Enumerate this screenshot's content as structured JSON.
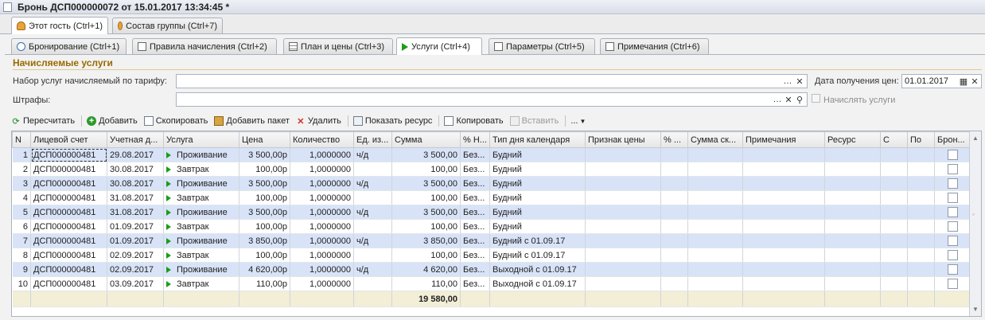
{
  "window": {
    "title": "Бронь ДСП000000072 от 15.01.2017 13:34:45 *"
  },
  "top_tabs": [
    {
      "label": "Этот гость (Ctrl+1)",
      "icon": "person-icon"
    },
    {
      "label": "Состав группы (Ctrl+7)",
      "icon": "group-icon"
    }
  ],
  "sub_tabs": [
    {
      "label": "Бронирование (Ctrl+1)",
      "icon": "clock-icon"
    },
    {
      "label": "Правила начисления (Ctrl+2)",
      "icon": "rules-icon"
    },
    {
      "label": "План и цены (Ctrl+3)",
      "icon": "table-icon"
    },
    {
      "label": "Услуги (Ctrl+4)",
      "icon": "play-icon"
    },
    {
      "label": "Параметры (Ctrl+5)",
      "icon": "params-icon"
    },
    {
      "label": "Примечания (Ctrl+6)",
      "icon": "note-icon"
    }
  ],
  "section": {
    "title": "Начисляемые услуги"
  },
  "form": {
    "services_label": "Набор услуг начисляемый по тарифу:",
    "services_value": "",
    "price_date_label": "Дата получения цен:",
    "price_date_value": "01.01.2017",
    "fines_label": "Штрафы:",
    "fines_value": "",
    "charge_services_label": "Начислять услуги"
  },
  "toolbar": {
    "recalc": "Пересчитать",
    "add": "Добавить",
    "copy": "Скопировать",
    "add_package": "Добавить пакет",
    "delete": "Удалить",
    "show_resource": "Показать ресурс",
    "copy2": "Копировать",
    "paste": "Вставить",
    "more": "..."
  },
  "table": {
    "columns": [
      "N",
      "Лицевой счет",
      "Учетная д...",
      "Услуга",
      "Цена",
      "Количество",
      "Ед. из...",
      "Сумма",
      "% Н...",
      "Тип дня календаря",
      "Признак цены",
      "% ...",
      "Сумма ск...",
      "Примечания",
      "Ресурс",
      "С",
      "По",
      "Брон..."
    ],
    "rows": [
      {
        "n": "1",
        "account": "ДСП000000481",
        "date": "29.08.2017",
        "service": "Проживание",
        "price": "3 500,00р",
        "qty": "1,0000000",
        "unit": "ч/д",
        "sum": "3 500,00",
        "vat": "Без...",
        "day_type": "Будний"
      },
      {
        "n": "2",
        "account": "ДСП000000481",
        "date": "30.08.2017",
        "service": "Завтрак",
        "price": "100,00р",
        "qty": "1,0000000",
        "unit": "",
        "sum": "100,00",
        "vat": "Без...",
        "day_type": "Будний"
      },
      {
        "n": "3",
        "account": "ДСП000000481",
        "date": "30.08.2017",
        "service": "Проживание",
        "price": "3 500,00р",
        "qty": "1,0000000",
        "unit": "ч/д",
        "sum": "3 500,00",
        "vat": "Без...",
        "day_type": "Будний"
      },
      {
        "n": "4",
        "account": "ДСП000000481",
        "date": "31.08.2017",
        "service": "Завтрак",
        "price": "100,00р",
        "qty": "1,0000000",
        "unit": "",
        "sum": "100,00",
        "vat": "Без...",
        "day_type": "Будний"
      },
      {
        "n": "5",
        "account": "ДСП000000481",
        "date": "31.08.2017",
        "service": "Проживание",
        "price": "3 500,00р",
        "qty": "1,0000000",
        "unit": "ч/д",
        "sum": "3 500,00",
        "vat": "Без...",
        "day_type": "Будний"
      },
      {
        "n": "6",
        "account": "ДСП000000481",
        "date": "01.09.2017",
        "service": "Завтрак",
        "price": "100,00р",
        "qty": "1,0000000",
        "unit": "",
        "sum": "100,00",
        "vat": "Без...",
        "day_type": "Будний"
      },
      {
        "n": "7",
        "account": "ДСП000000481",
        "date": "01.09.2017",
        "service": "Проживание",
        "price": "3 850,00р",
        "qty": "1,0000000",
        "unit": "ч/д",
        "sum": "3 850,00",
        "vat": "Без...",
        "day_type": "Будний с 01.09.17"
      },
      {
        "n": "8",
        "account": "ДСП000000481",
        "date": "02.09.2017",
        "service": "Завтрак",
        "price": "100,00р",
        "qty": "1,0000000",
        "unit": "",
        "sum": "100,00",
        "vat": "Без...",
        "day_type": "Будний с 01.09.17"
      },
      {
        "n": "9",
        "account": "ДСП000000481",
        "date": "02.09.2017",
        "service": "Проживание",
        "price": "4 620,00р",
        "qty": "1,0000000",
        "unit": "ч/д",
        "sum": "4 620,00",
        "vat": "Без...",
        "day_type": "Выходной с 01.09.17"
      },
      {
        "n": "10",
        "account": "ДСП000000481",
        "date": "03.09.2017",
        "service": "Завтрак",
        "price": "110,00р",
        "qty": "1,0000000",
        "unit": "",
        "sum": "110,00",
        "vat": "Без...",
        "day_type": "Выходной с 01.09.17"
      }
    ],
    "total_sum": "19 580,00"
  }
}
